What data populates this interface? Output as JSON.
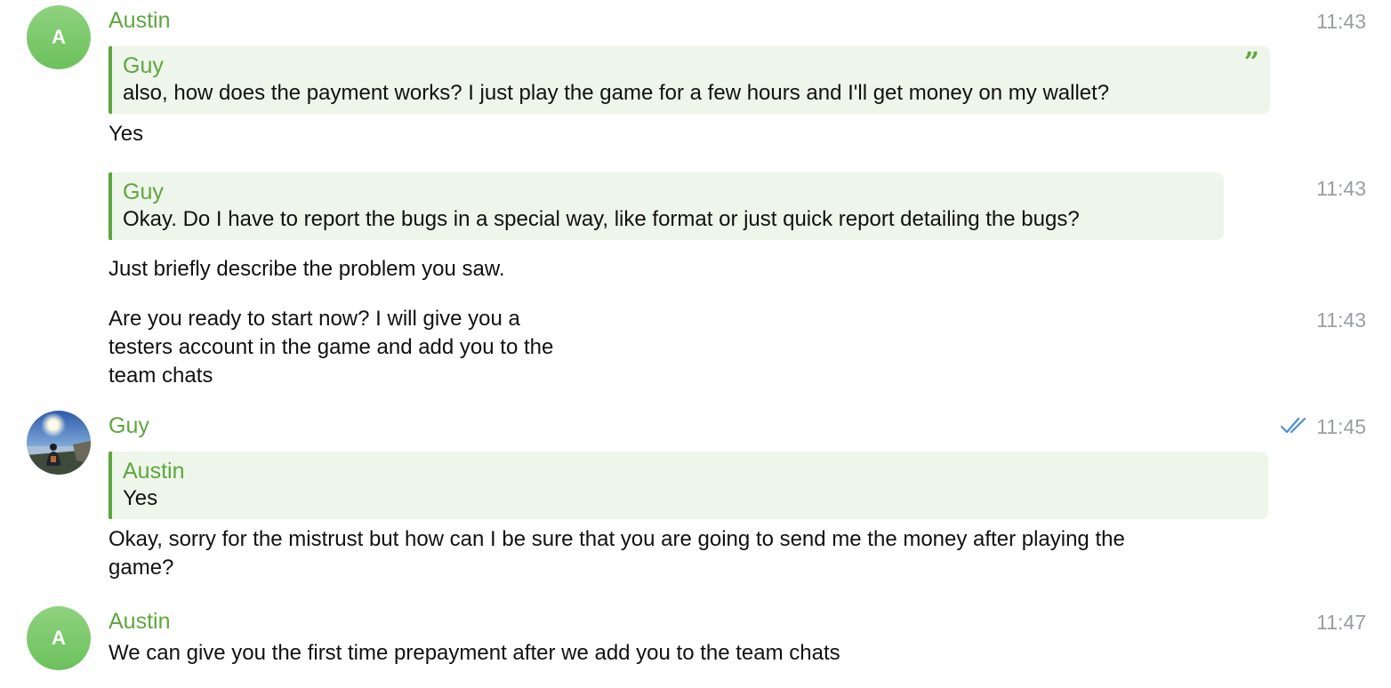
{
  "messages": [
    {
      "sender": "Austin",
      "avatar_letter": "A",
      "time": "11:43",
      "reply": {
        "name": "Guy",
        "text": "also, how does the payment works? I just play the game for a few hours and I'll get money on my wallet?",
        "quote_icon": "”"
      },
      "text": "Yes"
    },
    {
      "time": "11:43",
      "reply": {
        "name": "Guy",
        "text": "Okay. Do I have to report the bugs in a special way, like format or just quick report detailing the bugs?"
      },
      "text": "Just briefly describe the problem you saw."
    },
    {
      "time": "11:43",
      "text_lines": [
        "Are you ready to start now? I will give you a",
        "testers account in the game and add you to the",
        "team chats"
      ]
    },
    {
      "sender": "Guy",
      "avatar": "profile-photo",
      "time": "11:45",
      "status_icon": "double-check-icon",
      "reply": {
        "name": "Austin",
        "text": "Yes"
      },
      "text_lines": [
        "Okay, sorry for the mistrust but how can I be sure that you are going to send me the money after playing the",
        "game?"
      ]
    },
    {
      "sender": "Austin",
      "avatar_letter": "A",
      "time": "11:47",
      "text": "We can give you the first time prepayment after we add you to the team chats"
    }
  ],
  "colors": {
    "accent": "#5ea63f",
    "reply_bg": "#eef5ea",
    "time": "#9a9ea3",
    "check": "#4a8fd6"
  }
}
